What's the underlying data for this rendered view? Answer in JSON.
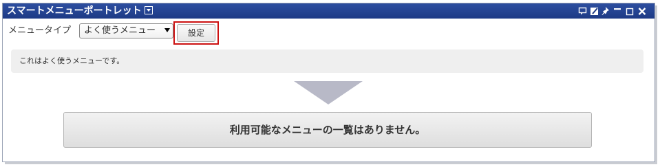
{
  "portlet": {
    "title": "スマートメニューポートレット",
    "header_controls": [
      "comment-icon",
      "edit-icon",
      "pin-icon",
      "minimize-icon",
      "maximize-icon",
      "close-icon"
    ]
  },
  "toolbar": {
    "menu_type_label": "メニュータイプ",
    "menu_type_selected": "よく使うメニュー",
    "set_button_label": "設定"
  },
  "description": "これはよく使うメニューです。",
  "result": {
    "empty_message": "利用可能なメニューの一覧はありません。"
  },
  "colors": {
    "titlebar": "#1d3a85",
    "highlight_border": "#cc1111",
    "arrow": "#b8b9c7",
    "description_bg": "#efefef"
  }
}
